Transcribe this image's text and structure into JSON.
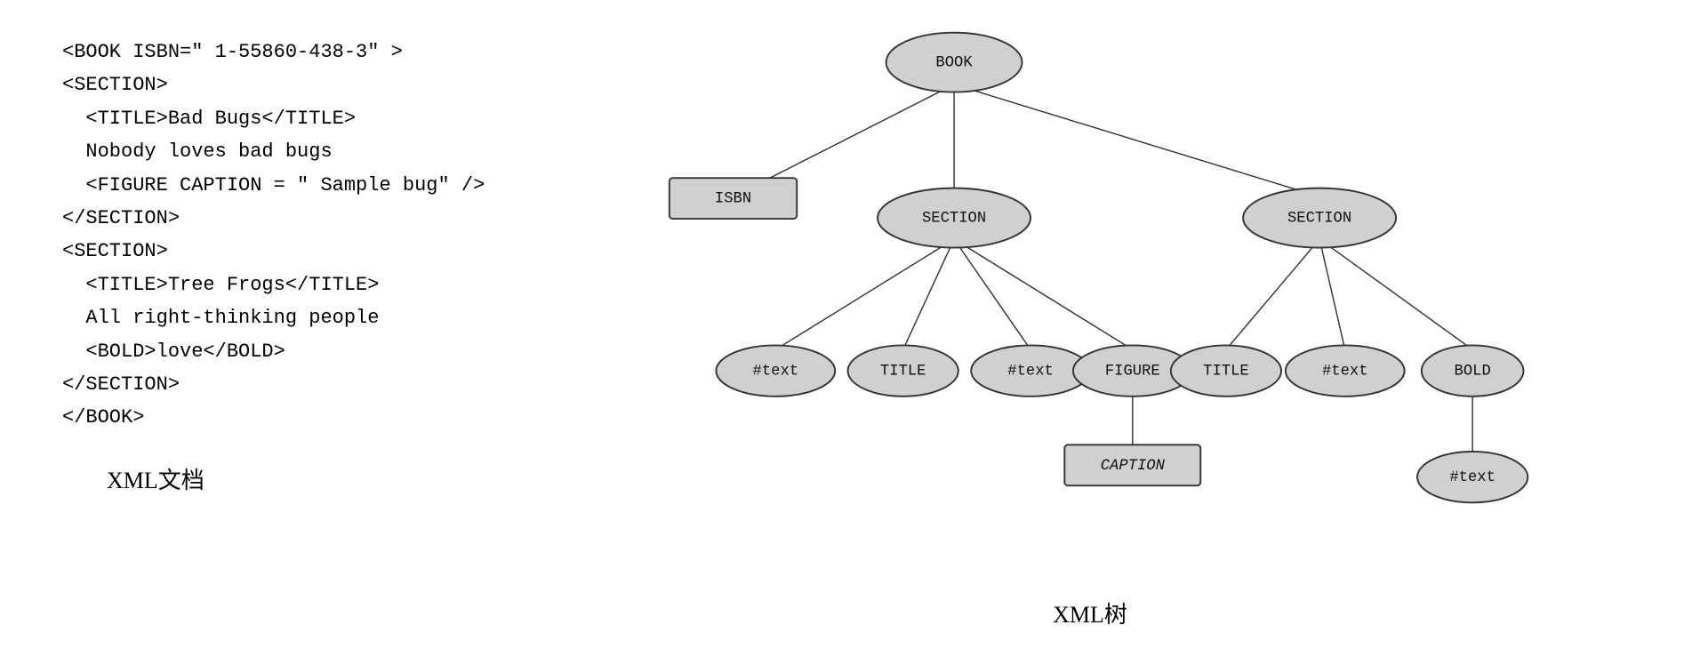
{
  "left": {
    "label": "XML文档",
    "lines": [
      "<BOOK ISBN=\" 1-55860-438-3\" >",
      "  <SECTION>",
      "    <TITLE>Bad Bugs</TITLE>",
      "    Nobody loves bad bugs",
      "    <FIGURE CAPTION = \" Sample bug\" />",
      "  </SECTION>",
      "  <SECTION>",
      "    <TITLE>Tree Frogs</TITLE>",
      "    All right-thinking people",
      "    <BOLD>love</BOLD>",
      "  </SECTION>",
      "</BOOK>"
    ]
  },
  "right": {
    "label": "XML树",
    "nodes": {
      "BOOK": "BOOK",
      "ISBN": "ISBN",
      "SECTION1": "SECTION",
      "SECTION2": "SECTION",
      "text1": "#text",
      "TITLE1": "TITLE",
      "text2": "#text",
      "FIGURE": "FIGURE",
      "TITLE2": "TITLE",
      "text3": "#text",
      "BOLD": "BOLD",
      "CAPTION": "CAPTION",
      "text4": "#text"
    }
  }
}
